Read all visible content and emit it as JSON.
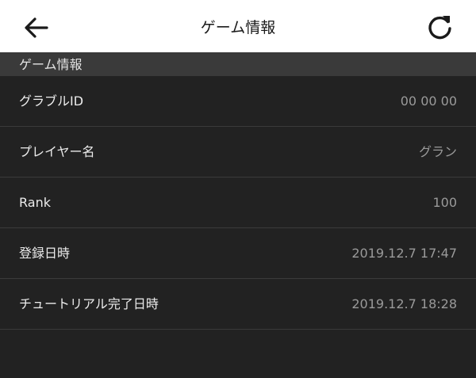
{
  "navbar": {
    "title": "ゲーム情報",
    "back_icon": "back-arrow-icon",
    "refresh_icon": "refresh-icon"
  },
  "section": {
    "title": "ゲーム情報"
  },
  "rows": [
    {
      "label": "グラブルID",
      "value": "00 00 00"
    },
    {
      "label": "プレイヤー名",
      "value": "グラン"
    },
    {
      "label": "Rank",
      "value": "100"
    },
    {
      "label": "登録日時",
      "value": "2019.12.7 17:47"
    },
    {
      "label": "チュートリアル完了日時",
      "value": "2019.12.7 18:28"
    }
  ],
  "colors": {
    "background": "#222222",
    "navbar": "#ffffff",
    "section_header": "#3a3a3a",
    "label_text": "#ececec",
    "value_text": "#9a9a9a"
  }
}
